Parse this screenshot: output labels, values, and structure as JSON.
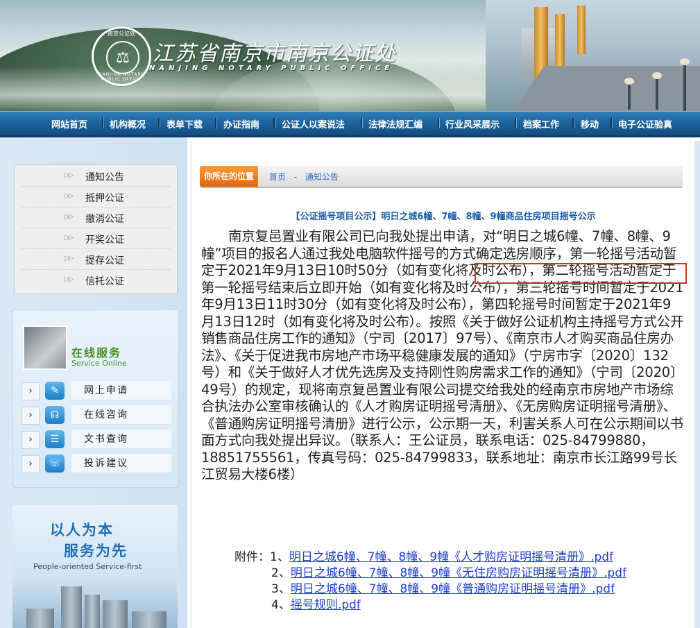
{
  "header": {
    "title": "江苏省南京市南京公证处",
    "subtitle": "NANJING NOTARY PUBLIC OFFICE",
    "seal_top": "南京公证处",
    "seal_bottom": "NANJING NOTARY PUBLIC OFFICE"
  },
  "nav": {
    "items": [
      "网站首页",
      "机构概况",
      "表单下载",
      "办证指南",
      "公证人以案说法",
      "法律法规汇编",
      "行业风采展示",
      "档案工作",
      "移动",
      "电子公证验真"
    ]
  },
  "sidebar": {
    "menu": [
      "通知公告",
      "抵押公证",
      "撤消公证",
      "开奖公证",
      "提存公证",
      "信托公证"
    ],
    "service": {
      "title": "在线服务",
      "subtitle": "Service Online",
      "items": [
        "网上申请",
        "在线咨询",
        "文书查询",
        "投诉建议"
      ]
    },
    "promo": {
      "line1": "以人为本",
      "line2": "服务为先",
      "english": "People-oriented Service-first"
    }
  },
  "breadcrumb": {
    "tag": "你所在的位置",
    "home": "首页",
    "sep": "-",
    "current": "通知公告"
  },
  "article": {
    "title": "【公证摇号项目公示】明日之城6幢、7幢、8幢、9幢商品住房项目摇号公示",
    "body": "南京复邑置业有限公司已向我处提出申请，对“明日之城6幢、7幢、8幢、9幢”项目的报名人通过我处电脑软件摇号的方式确定选房顺序，第一轮摇号活动暂定于2021年9月13日10时50分（如有变化将及时公布），第二轮摇号活动暂定于第一轮摇号结束后立即开始（如有变化将及时公布），第三轮摇号时间暂定于2021年9月13日11时30分（如有变化将及时公布），第四轮摇号时间暂定于2021年9月13日12时（如有变化将及时公布）。按照《关于做好公证机构主持摇号方式公开销售商品住房工作的通知》（宁司〔2017〕97号）、《南京市人才购买商品住房办法》、《关于促进我市房地产市场平稳健康发展的通知》（宁房市字〔2020〕132号）和《关于做好人才优先选房及支持刚性购房需求工作的通知》（宁司〔2020〕49号）的规定，现将南京复邑置业有限公司提交给我处的经南京市房地产市场综合执法办公室审核确认的《人才购房证明摇号清册》、《无房购房证明摇号清册》、《普通购房证明摇号清册》进行公示，公示期一天，利害关系人可在公示期间以书面方式向我处提出异议。（联系人：王公证员，联系电话：025-84799880，18851755561，传真号码：025-84799833，联系地址：南京市长江路99号长江贸易大楼6楼）",
    "attachments_label": "附件：",
    "attachments": [
      {
        "num": "1、",
        "name": "明日之城6幢、7幢、8幢、9幢《人才购房证明摇号清册》.pdf"
      },
      {
        "num": "2、",
        "name": "明日之城6幢、7幢、8幢、9幢《无住房购房证明摇号清册》.pdf"
      },
      {
        "num": "3、",
        "name": "明日之城6幢、7幢、8幢、9幢《普通购房证明摇号清册》.pdf"
      },
      {
        "num": "4、",
        "name": "摇号规则.pdf"
      }
    ]
  },
  "colors": {
    "nav_bg": "#1e64a0",
    "accent_orange": "#e2660c",
    "link_blue": "#1f3fc7",
    "highlight_red": "#d9302b"
  }
}
